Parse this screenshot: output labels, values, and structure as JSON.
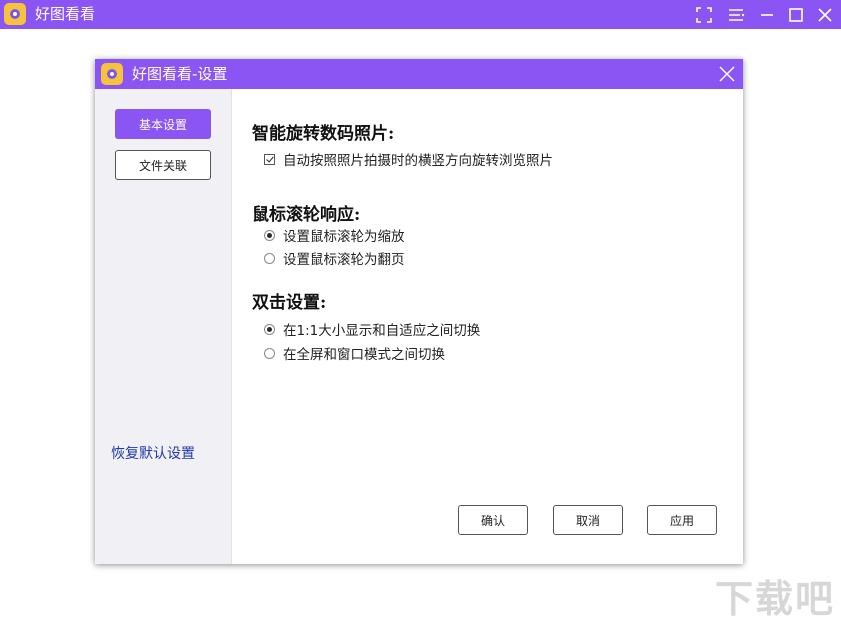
{
  "app": {
    "title": "好图看看",
    "accent_color": "#8a55f2",
    "window_buttons": [
      "fullscreen-icon",
      "menu-icon",
      "minimize-icon",
      "maximize-icon",
      "close-icon"
    ]
  },
  "dialog": {
    "title": "好图看看-设置",
    "sidebar": {
      "tabs": [
        {
          "label": "基本设置",
          "active": true
        },
        {
          "label": "文件关联",
          "active": false
        }
      ],
      "restore_link": "恢复默认设置"
    },
    "sections": {
      "rotate": {
        "title": "智能旋转数码照片:",
        "options": [
          {
            "label": "自动按照照片拍摄时的横竖方向旋转浏览照片",
            "checked": true
          }
        ]
      },
      "wheel": {
        "title": "鼠标滚轮响应:",
        "options": [
          {
            "label": "设置鼠标滚轮为缩放",
            "selected": true
          },
          {
            "label": "设置鼠标滚轮为翻页",
            "selected": false
          }
        ]
      },
      "dblclick": {
        "title": "双击设置:",
        "options": [
          {
            "label": "在1:1大小显示和自适应之间切换",
            "selected": true
          },
          {
            "label": "在全屏和窗口模式之间切换",
            "selected": false
          }
        ]
      }
    },
    "buttons": {
      "ok": "确认",
      "cancel": "取消",
      "apply": "应用"
    }
  },
  "watermark": "下载吧"
}
